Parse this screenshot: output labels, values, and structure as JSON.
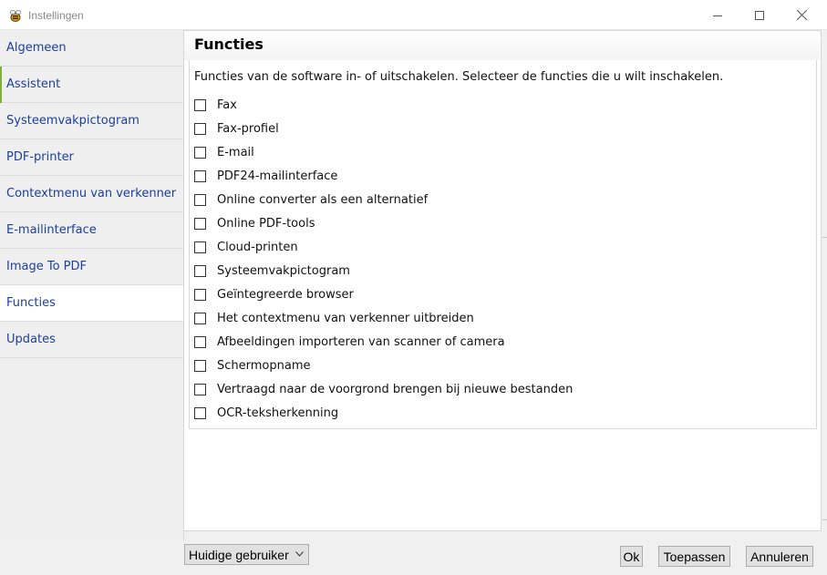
{
  "window": {
    "title": "Instellingen",
    "icon": "bee-app-icon"
  },
  "sidebar": {
    "items": [
      {
        "label": "Algemeen",
        "active": false
      },
      {
        "label": "Assistent",
        "active": false
      },
      {
        "label": "Systeemvakpictogram",
        "active": false
      },
      {
        "label": "PDF-printer",
        "active": false
      },
      {
        "label": "Contextmenu van verkenner",
        "active": false
      },
      {
        "label": "E-mailinterface",
        "active": false
      },
      {
        "label": "Image To PDF",
        "active": false
      },
      {
        "label": "Functies",
        "active": true
      },
      {
        "label": "Updates",
        "active": false
      }
    ]
  },
  "main": {
    "title": "Functies",
    "description": "Functies van de software in- of uitschakelen. Selecteer de functies die u wilt inschakelen.",
    "options": [
      {
        "label": "Fax",
        "checked": false
      },
      {
        "label": "Fax-profiel",
        "checked": false
      },
      {
        "label": "E-mail",
        "checked": false
      },
      {
        "label": "PDF24-mailinterface",
        "checked": false
      },
      {
        "label": "Online converter als een alternatief",
        "checked": false
      },
      {
        "label": "Online PDF-tools",
        "checked": false
      },
      {
        "label": "Cloud-printen",
        "checked": false
      },
      {
        "label": "Systeemvakpictogram",
        "checked": false
      },
      {
        "label": "Geïntegreerde browser",
        "checked": false
      },
      {
        "label": "Het contextmenu van verkenner uitbreiden",
        "checked": false
      },
      {
        "label": "Afbeeldingen importeren van scanner of camera",
        "checked": false
      },
      {
        "label": "Schermopname",
        "checked": false
      },
      {
        "label": "Vertraagd naar de voorgrond brengen bij nieuwe bestanden",
        "checked": false
      },
      {
        "label": "OCR-teksherkenning",
        "checked": false
      }
    ]
  },
  "footer": {
    "user_select": "Huidige gebruiker",
    "ok_label": "Ok",
    "apply_label": "Toepassen",
    "cancel_label": "Annuleren"
  },
  "colors": {
    "link": "#1c3f9a",
    "sidebar_bg": "#efefef",
    "accent": "#7fb03c"
  }
}
